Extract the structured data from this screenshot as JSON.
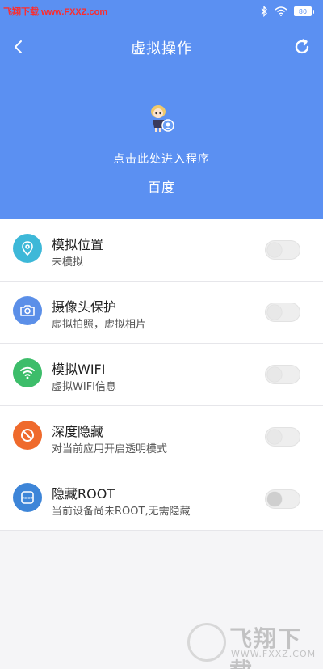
{
  "status_bar": {
    "watermark_text": "飞翔下载 www.FXXZ.com",
    "battery_level": "80"
  },
  "nav": {
    "title": "虚拟操作"
  },
  "app": {
    "enter_text": "点击此处进入程序",
    "name": "百度"
  },
  "items": [
    {
      "title": "模拟位置",
      "subtitle": "未模拟",
      "icon": "location-pin-icon",
      "color": "#3db8d8",
      "enabled": false
    },
    {
      "title": "摄像头保护",
      "subtitle": "虚拟拍照，虚拟相片",
      "icon": "camera-icon",
      "color": "#5b8fe8",
      "enabled": false
    },
    {
      "title": "模拟WIFI",
      "subtitle": "虚拟WIFI信息",
      "icon": "wifi-icon",
      "color": "#3dbd6a",
      "enabled": false
    },
    {
      "title": "深度隐藏",
      "subtitle": "对当前应用开启透明模式",
      "icon": "prohibited-icon",
      "color": "#ef6a2c",
      "enabled": false
    },
    {
      "title": "隐藏ROOT",
      "subtitle": "当前设备尚未ROOT,无需隐藏",
      "icon": "root-chip-icon",
      "color": "#3d85d8",
      "enabled": false
    }
  ],
  "colors": {
    "header": "#5b90f2",
    "background": "#f5f5f7"
  },
  "watermark": {
    "big": "飞翔下载",
    "small": "WWW.FXXZ.COM"
  }
}
